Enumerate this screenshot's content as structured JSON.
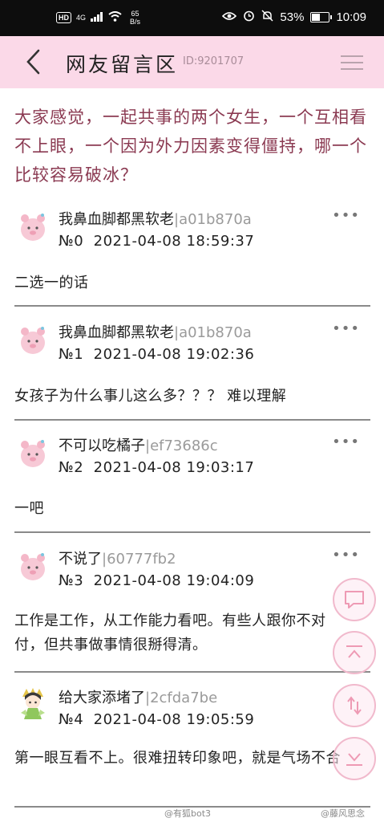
{
  "status_bar": {
    "hd": "HD",
    "signal": "4G",
    "speed_value": "65",
    "speed_unit": "B/s",
    "battery": "53%",
    "time": "10:09"
  },
  "nav": {
    "title": "网友留言区",
    "id": "ID:9201707"
  },
  "question": "大家感觉，一起共事的两个女生，一个互相看不上眼，一个因为外力因素变得僵持，哪一个比较容易破冰？",
  "posts": [
    {
      "name": "我鼻血脚都黑软老",
      "uid": "|a01b870a",
      "no": "№0",
      "time": "2021-04-08 18:59:37",
      "content": "二选一的话"
    },
    {
      "name": "我鼻血脚都黑软老",
      "uid": "|a01b870a",
      "no": "№1",
      "time": "2021-04-08 19:02:36",
      "content": "女孩子为什么事儿这么多？？？ 难以理解"
    },
    {
      "name": "不可以吃橘子",
      "uid": "|ef73686c",
      "no": "№2",
      "time": "2021-04-08 19:03:17",
      "content": "一吧"
    },
    {
      "name": "不说了",
      "uid": "|60777fb2",
      "no": "№3",
      "time": "2021-04-08 19:04:09",
      "content": "工作是工作，从工作能力看吧。有些人跟你不对付，但共事做事情很掰得清。"
    },
    {
      "name": "给大家添堵了",
      "uid": "|2cfda7be",
      "no": "№4",
      "time": "2021-04-08 19:05:59",
      "content": "第一眼互看不上。很难扭转印象吧，就是气场不合"
    }
  ],
  "more_label": "•••",
  "watermarks": [
    "@有狐bot3",
    "@藤风思念"
  ],
  "colors": {
    "status_bar_bg": "#0d0d0d",
    "nav_bg": "#fbd9e8",
    "question_text": "#8b3a52",
    "uid_text": "#9a9a9a",
    "float_border": "#f1b9cc"
  },
  "icons": {
    "back": "chevron-left-icon",
    "menu": "hamburger-menu-icon",
    "more": "more-dots-icon",
    "comment": "comment-bubble-icon",
    "top": "scroll-top-icon",
    "refresh": "refresh-icon"
  }
}
